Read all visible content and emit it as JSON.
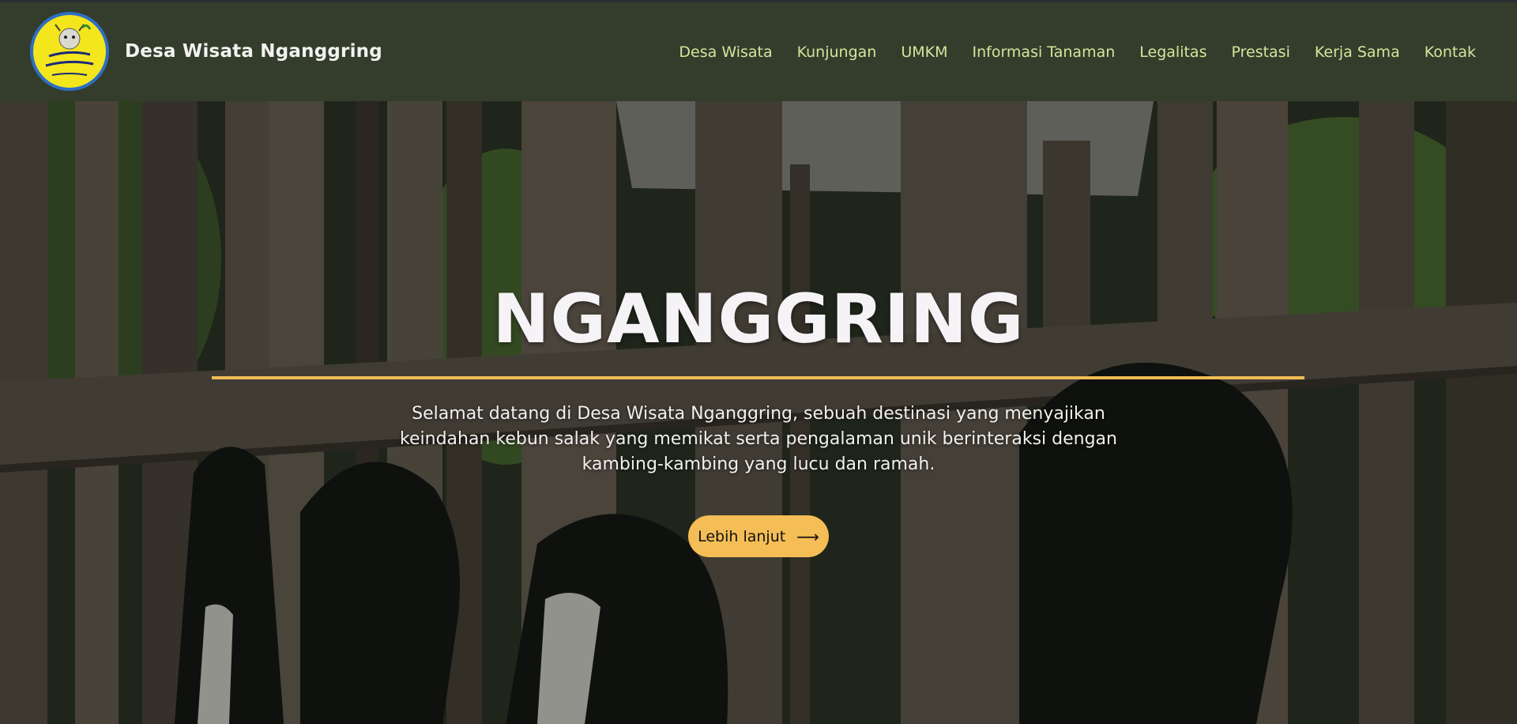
{
  "header": {
    "brand_name": "Desa Wisata Nganggring",
    "logo_text": [
      "Desa Wisata",
      "Nganggring"
    ],
    "nav": [
      {
        "label": "Desa Wisata"
      },
      {
        "label": "Kunjungan"
      },
      {
        "label": "UMKM"
      },
      {
        "label": "Informasi Tanaman"
      },
      {
        "label": "Legalitas"
      },
      {
        "label": "Prestasi"
      },
      {
        "label": "Kerja Sama"
      },
      {
        "label": "Kontak"
      }
    ]
  },
  "hero": {
    "title": "NGANGGRING",
    "description": "Selamat datang di Desa Wisata Nganggring, sebuah destinasi yang menyajikan keindahan kebun salak yang memikat serta pengalaman unik berinteraksi dengan kambing-kambing yang lucu dan ramah.",
    "cta_label": "Lebih lanjut",
    "cta_icon": "arrow-right-icon"
  },
  "colors": {
    "navbar_bg": "#343c2c",
    "nav_link": "#cfe89a",
    "accent": "#f4bd55"
  }
}
